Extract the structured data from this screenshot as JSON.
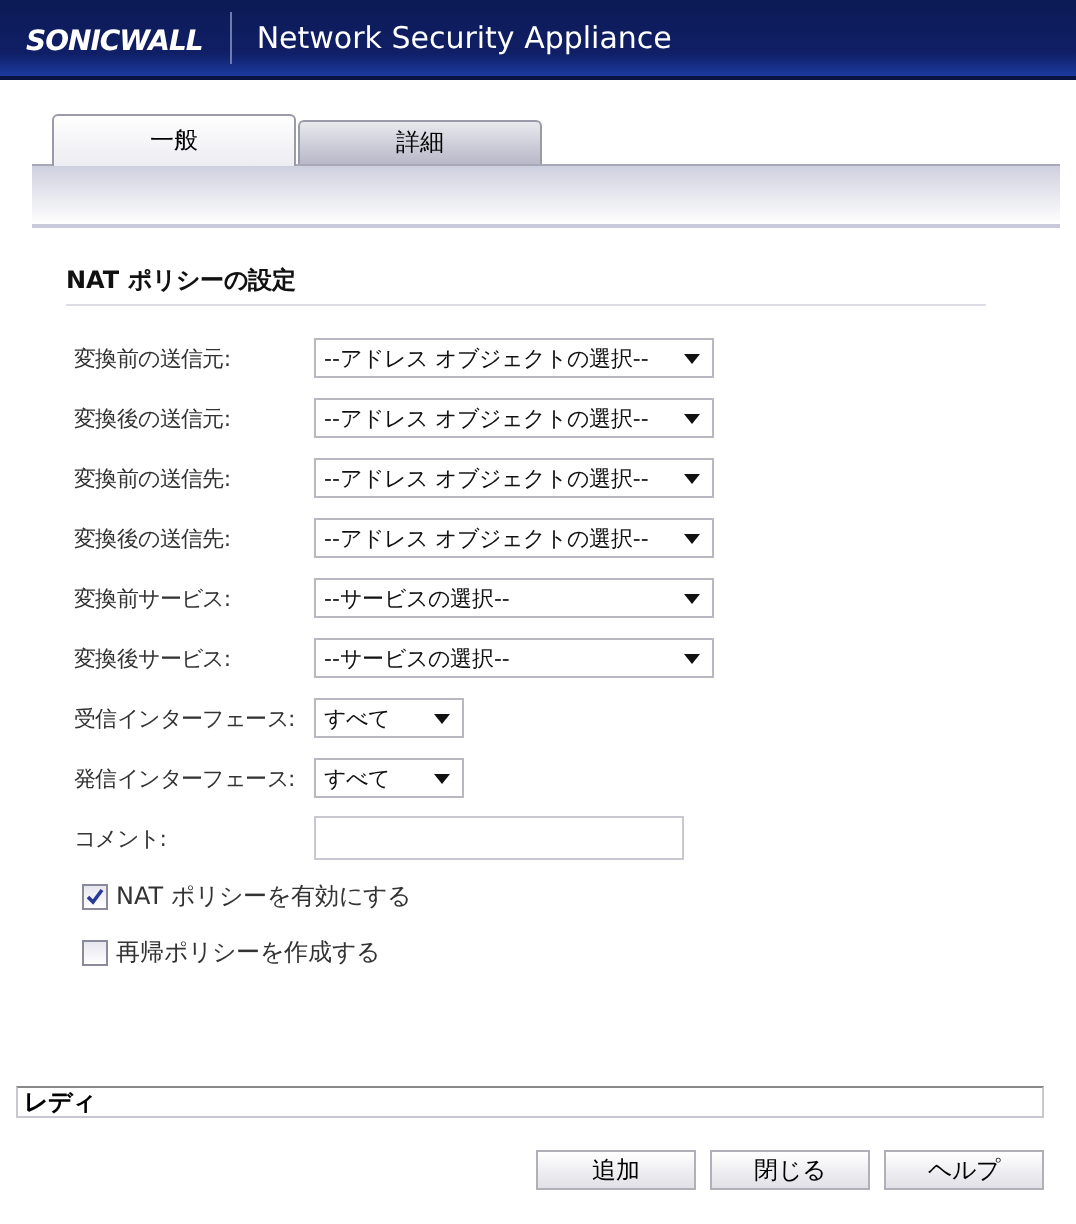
{
  "header": {
    "logo": "SONICWALL",
    "title": "Network Security Appliance"
  },
  "tabs": [
    {
      "label": "一般",
      "selected": true
    },
    {
      "label": "詳細",
      "selected": false
    }
  ],
  "section": {
    "title": "NAT ポリシーの設定"
  },
  "fields": [
    {
      "label": "変換前の送信元:",
      "kind": "select",
      "value": "--アドレス オブジェクトの選択--"
    },
    {
      "label": "変換後の送信元:",
      "kind": "select",
      "value": "--アドレス オブジェクトの選択--"
    },
    {
      "label": "変換前の送信先:",
      "kind": "select",
      "value": "--アドレス オブジェクトの選択--"
    },
    {
      "label": "変換後の送信先:",
      "kind": "select",
      "value": "--アドレス オブジェクトの選択--"
    },
    {
      "label": "変換前サービス:",
      "kind": "select",
      "value": "--サービスの選択--"
    },
    {
      "label": "変換後サービス:",
      "kind": "select",
      "value": "--サービスの選択--"
    },
    {
      "label": "受信インターフェース:",
      "kind": "compact-select",
      "value": "すべて"
    },
    {
      "label": "発信インターフェース:",
      "kind": "compact-select",
      "value": "すべて"
    },
    {
      "label": "コメント:",
      "kind": "text"
    }
  ],
  "options": [
    {
      "label": "NAT ポリシーを有効にする",
      "checked": true
    },
    {
      "label": "再帰ポリシーを作成する",
      "checked": false
    }
  ],
  "status_bar": {
    "text": "レディ"
  },
  "buttons": [
    "追加",
    "閉じる",
    "ヘルプ"
  ]
}
